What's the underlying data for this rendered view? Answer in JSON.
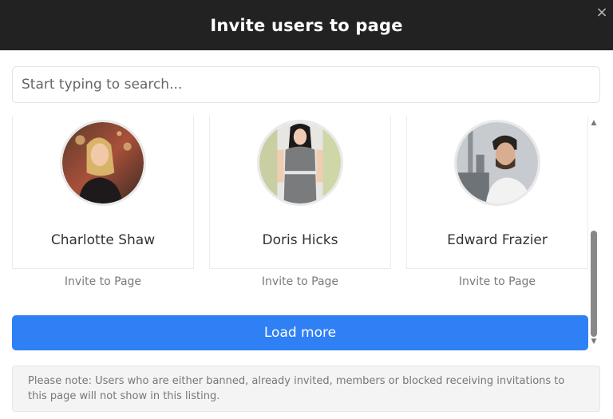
{
  "modal": {
    "title": "Invite users to page",
    "close_icon": "×"
  },
  "search": {
    "placeholder": "Start typing to search...",
    "value": ""
  },
  "users": [
    {
      "name": "Charlotte Shaw",
      "invite_label": "Invite to Page",
      "avatar_icon": "charlotte-avatar"
    },
    {
      "name": "Doris Hicks",
      "invite_label": "Invite to Page",
      "avatar_icon": "doris-avatar"
    },
    {
      "name": "Edward Frazier",
      "invite_label": "Invite to Page",
      "avatar_icon": "edward-avatar"
    }
  ],
  "scroll": {
    "up_icon": "▲",
    "down_icon": "▼"
  },
  "actions": {
    "load_more_label": "Load more"
  },
  "note": {
    "text": "Please note: Users who are either banned, already invited, members or blocked receiving invitations to this page will not show in this listing."
  },
  "colors": {
    "header_bg": "#222222",
    "primary_button": "#2f80f5",
    "note_bg": "#f4f4f4"
  }
}
